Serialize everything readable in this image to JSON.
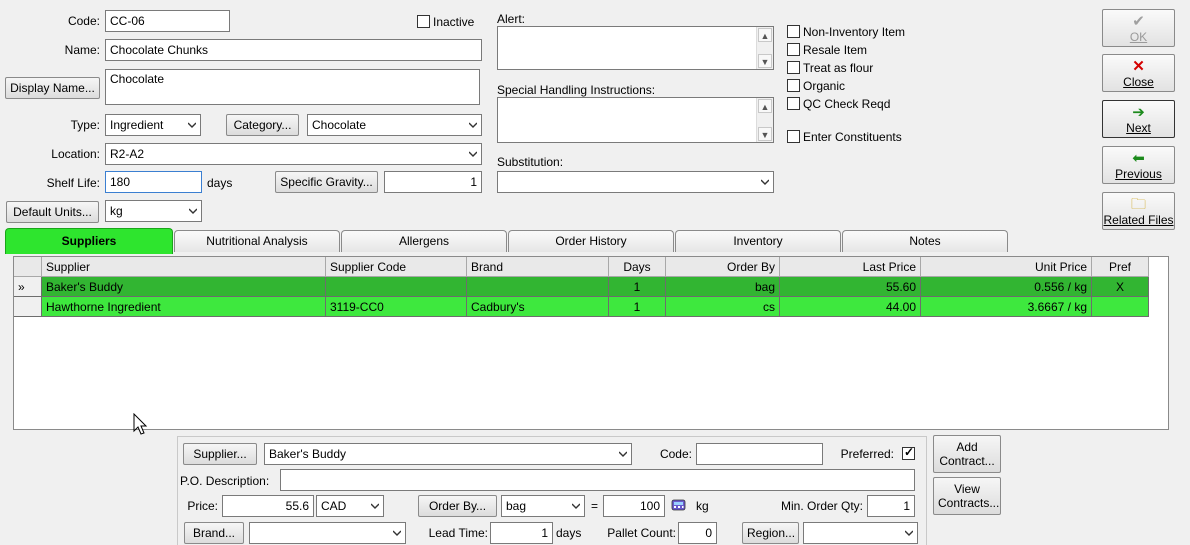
{
  "form": {
    "code_label": "Code:",
    "code_value": "CC-06",
    "inactive_label": "Inactive",
    "name_label": "Name:",
    "name_value": "Chocolate Chunks",
    "display_name_button": "Display Name...",
    "display_name_value": "Chocolate",
    "type_label": "Type:",
    "type_value": "Ingredient",
    "category_button": "Category...",
    "category_value": "Chocolate",
    "location_label": "Location:",
    "location_value": "R2-A2",
    "shelf_life_label": "Shelf Life:",
    "shelf_life_value": "180",
    "shelf_life_unit": "days",
    "specific_gravity_button": "Specific Gravity...",
    "specific_gravity_value": "1",
    "default_units_button": "Default Units...",
    "default_units_value": "kg",
    "alert_label": "Alert:",
    "special_handling_label": "Special Handling Instructions:",
    "substitution_label": "Substitution:",
    "substitution_value": ""
  },
  "options": {
    "non_inventory": "Non-Inventory Item",
    "resale": "Resale Item",
    "treat_as_flour": "Treat as flour",
    "organic": "Organic",
    "qc_check": "QC Check Reqd",
    "enter_constituents": "Enter Constituents"
  },
  "side_buttons": {
    "ok": "OK",
    "close": "Close",
    "next": "Next",
    "previous": "Previous",
    "related_files": "Related Files"
  },
  "tabs": [
    "Suppliers",
    "Nutritional Analysis",
    "Allergens",
    "Order History",
    "Inventory",
    "Notes"
  ],
  "grid": {
    "columns": [
      "Supplier",
      "Supplier Code",
      "Brand",
      "Days",
      "Order By",
      "Last Price",
      "Unit Price",
      "Pref"
    ],
    "rows": [
      {
        "indicator": "»",
        "supplier": "Baker's Buddy",
        "code": "",
        "brand": "",
        "days": "1",
        "order_by": "bag",
        "last_price": "55.60",
        "unit_price": "0.556 / kg",
        "pref": "X"
      },
      {
        "indicator": "",
        "supplier": "Hawthorne Ingredient",
        "code": "3119-CC0",
        "brand": "Cadbury's",
        "days": "1",
        "order_by": "cs",
        "last_price": "44.00",
        "unit_price": "3.6667 / kg",
        "pref": ""
      }
    ]
  },
  "detail": {
    "supplier_button": "Supplier...",
    "supplier_value": "Baker's Buddy",
    "code_label": "Code:",
    "code_value": "",
    "preferred_label": "Preferred:",
    "po_description_label": "P.O. Description:",
    "po_description_value": "",
    "price_label": "Price:",
    "price_value": "55.6",
    "currency_value": "CAD",
    "order_by_button": "Order By...",
    "order_by_value": "bag",
    "equals": "=",
    "qty_value": "100",
    "qty_unit": "kg",
    "min_order_label": "Min. Order Qty:",
    "min_order_value": "1",
    "brand_button": "Brand...",
    "brand_value": "",
    "lead_time_label": "Lead Time:",
    "lead_time_value": "1",
    "lead_time_unit": "days",
    "pallet_count_label": "Pallet Count:",
    "pallet_count_value": "0",
    "region_button": "Region...",
    "region_value": "",
    "add_contract": [
      "Add",
      "Contract..."
    ],
    "view_contracts": [
      "View",
      "Contracts..."
    ]
  },
  "colors": {
    "active_tab": "#2ee52e",
    "selected_row": "#32b532",
    "row": "#3ee83e",
    "close_x": "#d40000"
  }
}
